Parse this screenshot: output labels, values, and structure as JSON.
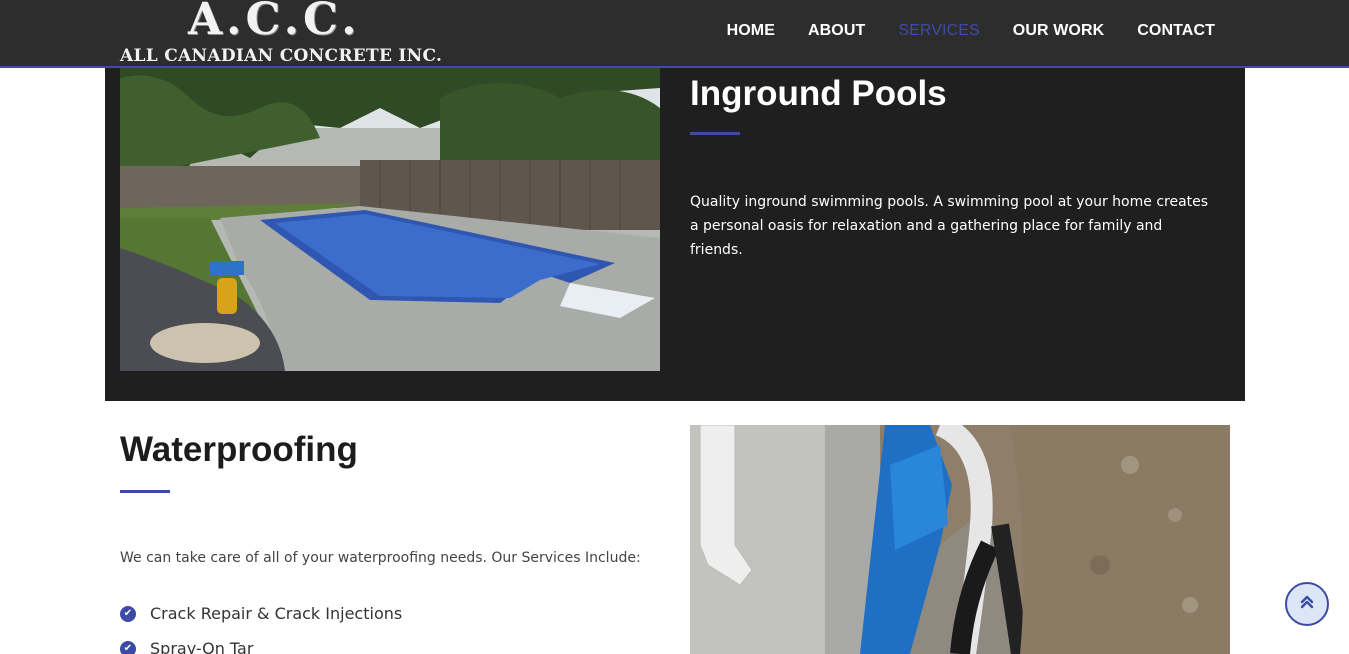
{
  "header": {
    "logo_mark": "A.C.C.",
    "logo_name": "ALL CANADIAN CONCRETE INC.",
    "nav": [
      {
        "label": "HOME"
      },
      {
        "label": "ABOUT"
      },
      {
        "label": "SERVICES"
      },
      {
        "label": "OUR WORK"
      },
      {
        "label": "CONTACT"
      }
    ],
    "active_nav": "SERVICES"
  },
  "pools": {
    "title": "Inground Pools",
    "description": "Quality inground swimming pools. A swimming pool at your home creates a personal oasis for relaxation and a gathering place for family and friends."
  },
  "waterproofing": {
    "title": "Waterproofing",
    "description": "We can take care of all of your waterproofing needs. Our Services Include:",
    "services": [
      {
        "label": "Crack Repair & Crack Injections"
      },
      {
        "label": "Spray-On Tar"
      }
    ]
  },
  "icons": {
    "check": "check-circle-icon",
    "back_to_top": "double-chevron-up-icon"
  },
  "colors": {
    "accent": "#3d4ba6",
    "header_bg": "#2d2d2d",
    "dark_section_bg": "#1f1f1f"
  }
}
